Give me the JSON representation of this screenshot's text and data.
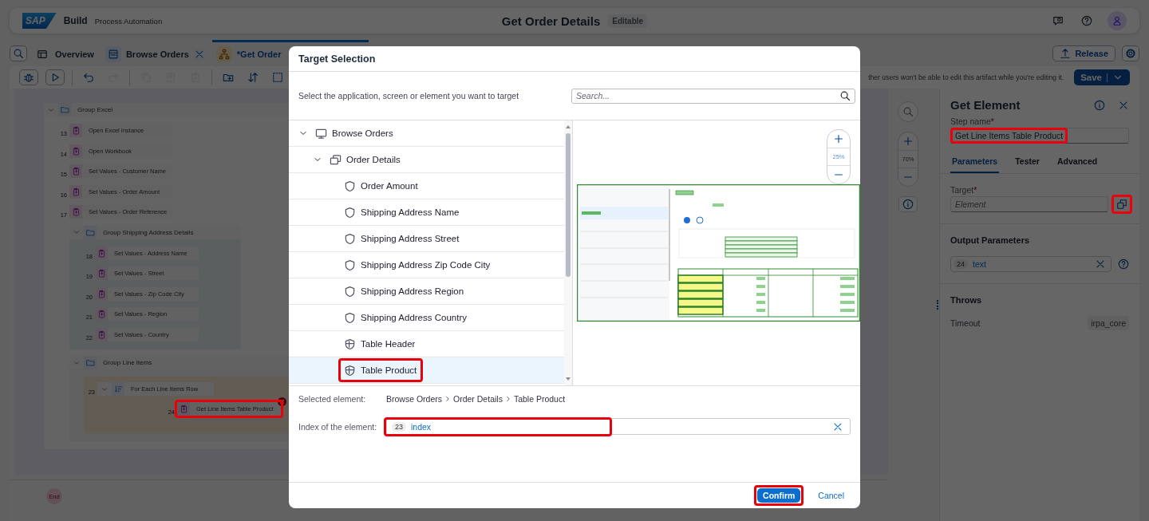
{
  "shell_bar": {
    "logo": "SAP",
    "product": "Build",
    "subtitle": "Process Automation",
    "title": "Get Order Details",
    "status": "Editable"
  },
  "editor_tabs": [
    {
      "kind": "overview",
      "label": "Overview",
      "selected": false,
      "closable": false
    },
    {
      "kind": "application",
      "label": "Browse Orders",
      "selected": false,
      "closable": true
    },
    {
      "kind": "automation",
      "label": "*Get Order",
      "selected": true,
      "closable": false
    }
  ],
  "release_button": "Release",
  "toolbar": {
    "actions": [
      {
        "kind": "debug",
        "disabled": false
      },
      {
        "kind": "run",
        "disabled": false
      },
      {
        "kind": "undo",
        "disabled": false
      },
      {
        "kind": "redo",
        "disabled": true
      },
      {
        "kind": "copy",
        "disabled": true
      },
      {
        "kind": "duplicate",
        "disabled": true
      },
      {
        "kind": "paste",
        "disabled": true
      },
      {
        "kind": "add-group",
        "disabled": false
      },
      {
        "kind": "sort",
        "disabled": false
      },
      {
        "kind": "select",
        "disabled": false
      }
    ],
    "notice": "ther users won't be able to edit this artifact while you're editing it.",
    "save_button": "Save"
  },
  "canvas": {
    "items": [
      {
        "kind": "group",
        "label": "Group Excel",
        "expanded": true,
        "children": [
          {
            "kind": "step",
            "number": "13",
            "label": "Open Excel Instance",
            "highlighted": false,
            "error": false
          },
          {
            "kind": "step",
            "number": "14",
            "label": "Open Workbook",
            "highlighted": false,
            "error": false
          },
          {
            "kind": "step",
            "number": "15",
            "label": "Set Values - Customer Name",
            "highlighted": false,
            "error": false
          },
          {
            "kind": "step",
            "number": "16",
            "label": "Set Values - Order Amount",
            "highlighted": false,
            "error": false
          },
          {
            "kind": "step",
            "number": "17",
            "label": "Set Values - Order Reference",
            "highlighted": false,
            "error": false
          },
          {
            "kind": "group",
            "label": "Group Shipping Address Details",
            "expanded": true,
            "children": [
              {
                "kind": "step",
                "number": "18",
                "label": "Set Values - Address Name",
                "highlighted": false,
                "error": false
              },
              {
                "kind": "step",
                "number": "19",
                "label": "Set Values - Street",
                "highlighted": false,
                "error": false
              },
              {
                "kind": "step",
                "number": "20",
                "label": "Set Values - Zip Code City",
                "highlighted": false,
                "error": false
              },
              {
                "kind": "step",
                "number": "21",
                "label": "Set Values - Region",
                "highlighted": false,
                "error": false
              },
              {
                "kind": "step",
                "number": "22",
                "label": "Set Values - Country",
                "highlighted": false,
                "error": false
              }
            ]
          },
          {
            "kind": "group",
            "label": "Group Line Items",
            "expanded": true,
            "children": [
              {
                "kind": "loop",
                "number": "23",
                "label": "For Each Line Items Row",
                "expanded": true,
                "children": [
                  {
                    "kind": "step",
                    "number": "24",
                    "label": "Get Line Items Table Product",
                    "highlighted": true,
                    "error": true
                  }
                ]
              }
            ]
          }
        ]
      }
    ],
    "zoom": "70%",
    "end_label": "End"
  },
  "properties_panel": {
    "title": "Get Element",
    "step_name": {
      "label": "Step name",
      "required_mark": "*",
      "value": "Get Line Items Table Product",
      "highlighted": true
    },
    "tabs": [
      {
        "label": "Parameters",
        "selected": true
      },
      {
        "label": "Tester",
        "selected": false
      },
      {
        "label": "Advanced",
        "selected": false
      }
    ],
    "target": {
      "label": "Target",
      "required_mark": "*",
      "placeholder": "Element",
      "button_highlighted": true
    },
    "output_title": "Output Parameters",
    "output": {
      "number": "24",
      "name": "text"
    },
    "throws_title": "Throws",
    "throws": [
      {
        "name": "Timeout",
        "source": "irpa_core"
      }
    ]
  },
  "dialog": {
    "title": "Target Selection",
    "instruction": "Select the application, screen or element you want to target",
    "search_placeholder": "Search...",
    "tree": [
      {
        "kind": "application",
        "label": "Browse Orders",
        "expanded": true,
        "selected": false,
        "highlighted": false,
        "children": [
          {
            "kind": "screen",
            "label": "Order Details",
            "expanded": true,
            "selected": false,
            "highlighted": false,
            "children": [
              {
                "kind": "element",
                "label": "Order Amount",
                "selected": false,
                "highlighted": false
              },
              {
                "kind": "element",
                "label": "Shipping Address Name",
                "selected": false,
                "highlighted": false
              },
              {
                "kind": "element",
                "label": "Shipping Address Street",
                "selected": false,
                "highlighted": false
              },
              {
                "kind": "element",
                "label": "Shipping Address Zip Code City",
                "selected": false,
                "highlighted": false
              },
              {
                "kind": "element",
                "label": "Shipping Address Region",
                "selected": false,
                "highlighted": false
              },
              {
                "kind": "element",
                "label": "Shipping Address Country",
                "selected": false,
                "highlighted": false
              },
              {
                "kind": "table",
                "label": "Table Header",
                "selected": false,
                "highlighted": false
              },
              {
                "kind": "table",
                "label": "Table Product",
                "selected": true,
                "highlighted": true
              }
            ]
          }
        ]
      }
    ],
    "preview_zoom": "25%",
    "selected_label": "Selected element:",
    "path": [
      "Browse Orders",
      "Order Details",
      "Table Product"
    ],
    "index_label": "Index of the element:",
    "index": {
      "number": "23",
      "name": "index",
      "highlighted": true
    },
    "confirm": {
      "label": "Confirm",
      "highlighted": true
    },
    "cancel": "Cancel"
  }
}
